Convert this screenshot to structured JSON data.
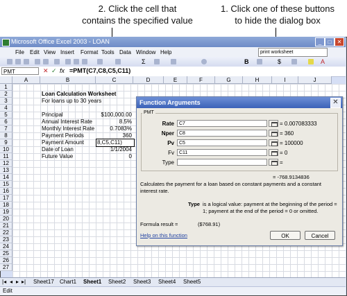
{
  "callouts": {
    "left_line1": "2. Click the cell that",
    "left_line2": "contains the specified value",
    "right_line1": "1. Click one of these buttons",
    "right_line2": "to hide the dialog box"
  },
  "window": {
    "title": "Microsoft Office Excel 2003 - LOAN"
  },
  "menu": [
    "File",
    "Edit",
    "View",
    "Insert",
    "Format",
    "Tools",
    "Data",
    "Window",
    "Help"
  ],
  "ask_box": "print worksheet",
  "formula_bar": {
    "name_box": "PMT",
    "fx": "fx",
    "formula": "=PMT(C7,C8,C5,C11)"
  },
  "columns": [
    "A",
    "B",
    "C",
    "D",
    "E",
    "F",
    "G",
    "H",
    "I",
    "J"
  ],
  "rows": [
    "1",
    "2",
    "3",
    "4",
    "5",
    "6",
    "7",
    "8",
    "9",
    "10",
    "11",
    "12",
    "13",
    "14",
    "15",
    "16",
    "17",
    "18",
    "19",
    "20",
    "21",
    "22",
    "23",
    "24",
    "25",
    "26",
    "27"
  ],
  "sheet": {
    "title": "Loan Calculation Worksheet",
    "subtitle": "For loans up to 30 years",
    "labels": [
      "Principal",
      "Annual Interest Rate",
      "Monthly Interest Rate",
      "Payment Periods",
      "Payment Amount",
      "Date of Loan",
      "Future Value"
    ],
    "values": [
      "$100,000.00",
      "8.5%",
      "0.7083%",
      "360",
      "8,C5,C11)",
      "1/1/2004",
      "0"
    ]
  },
  "tabs": [
    "Sheet17",
    "Chart1",
    "Sheet1",
    "Sheet2",
    "Sheet3",
    "Sheet4",
    "Sheet5"
  ],
  "status": "Edit",
  "dialog": {
    "title": "Function Arguments",
    "function_name": "PMT",
    "args": [
      {
        "label": "Rate",
        "value": "C7",
        "result": "= 0.007083333"
      },
      {
        "label": "Nper",
        "value": "C8",
        "result": "= 360"
      },
      {
        "label": "Pv",
        "value": "C5",
        "result": "= 100000"
      },
      {
        "label": "Fv",
        "value": "C11",
        "result": "= 0"
      },
      {
        "label": "Type",
        "value": "",
        "result": "="
      }
    ],
    "total_result": "= -768.9134836",
    "description": "Calculates the payment for a loan based on constant payments and a constant interest rate.",
    "type_help_label": "Type",
    "type_help": "is a logical value: payment at the beginning of the period = 1; payment at the end of the period = 0 or omitted.",
    "formula_result_label": "Formula result =",
    "formula_result_value": "($768.91)",
    "help_link": "Help on this function",
    "ok": "OK",
    "cancel": "Cancel"
  }
}
